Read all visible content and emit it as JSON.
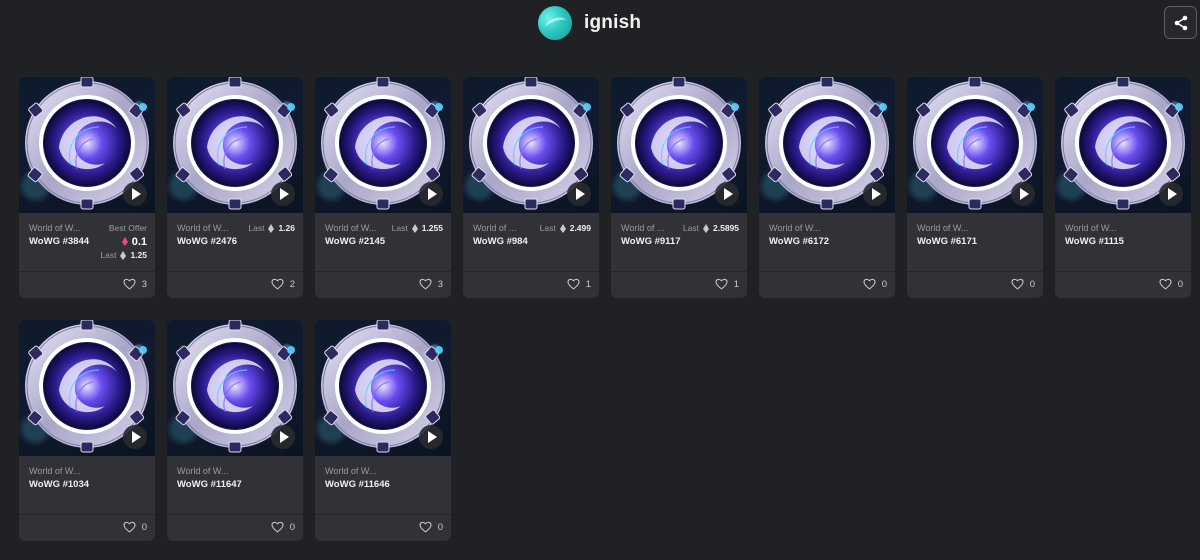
{
  "header": {
    "brand_name": "ignish",
    "logo_icon": "ignish-logo-icon",
    "share_icon": "share-icon"
  },
  "cards": [
    {
      "collection": "World of W...",
      "token": "WoWG #3844",
      "best_offer_label": "Best Offer",
      "best_offer_value": "0.1",
      "last_label": "Last",
      "last_value": "1.25",
      "likes": "3"
    },
    {
      "collection": "World of W...",
      "token": "WoWG #2476",
      "last_label": "Last",
      "last_value": "1.26",
      "likes": "2"
    },
    {
      "collection": "World of W...",
      "token": "WoWG #2145",
      "last_label": "Last",
      "last_value": "1.255",
      "likes": "3"
    },
    {
      "collection": "World of ...",
      "token": "WoWG #984",
      "last_label": "Last",
      "last_value": "2.499",
      "likes": "1"
    },
    {
      "collection": "World of ...",
      "token": "WoWG #9117",
      "last_label": "Last",
      "last_value": "2.5895",
      "likes": "1"
    },
    {
      "collection": "World of W...",
      "token": "WoWG #6172",
      "likes": "0"
    },
    {
      "collection": "World of W...",
      "token": "WoWG #6171",
      "likes": "0"
    },
    {
      "collection": "World of W...",
      "token": "WoWG #1115",
      "likes": "0"
    },
    {
      "collection": "World of W...",
      "token": "WoWG #1034",
      "likes": "0"
    },
    {
      "collection": "World of W...",
      "token": "WoWG #11647",
      "likes": "0"
    },
    {
      "collection": "World of W...",
      "token": "WoWG #11646",
      "likes": "0"
    }
  ],
  "colors": {
    "background": "#202124",
    "card": "#303237",
    "accent_teal": "#2bc7c0",
    "eth_pink": "#f3487c"
  }
}
